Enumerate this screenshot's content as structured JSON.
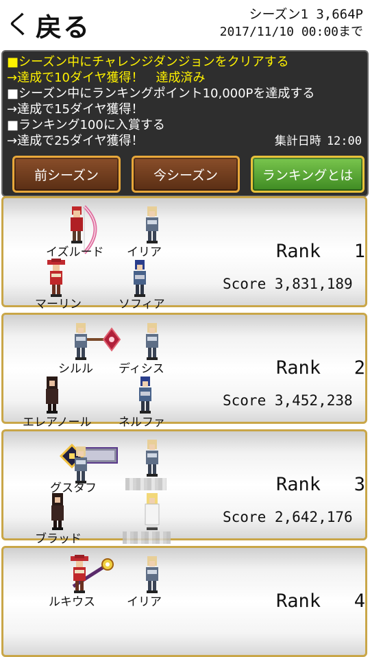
{
  "header": {
    "back_chevron": "く",
    "back_label": "戻る",
    "season_points": "シーズン1 3,664P",
    "season_end": "2017/11/10 00:00まで"
  },
  "mission": {
    "lines": [
      "■シーズン中にチャレンジダンジョンをクリアする",
      "→達成で10ダイヤ獲得！　達成済み",
      "■シーズン中にランキングポイント10,000Pを達成する",
      "→達成で15ダイヤ獲得！",
      "■ランキング100に入賞する",
      "→達成で25ダイヤ獲得！"
    ],
    "collect_label": "集計日時",
    "collect_time": "12:00"
  },
  "buttons": {
    "prev_season": "前シーズン",
    "current_season": "今シーズン",
    "about_ranking": "ランキングとは"
  },
  "ranks": [
    {
      "rank_text": "Rank   1",
      "score_text": "Score 3,831,189",
      "names": [
        "イズルード",
        "イリア",
        "マーリン",
        "ソフィア"
      ]
    },
    {
      "rank_text": "Rank   2",
      "score_text": "Score 3,452,238",
      "names": [
        "シルル",
        "ディシス",
        "エレアノール",
        "ネルファ"
      ]
    },
    {
      "rank_text": "Rank   3",
      "score_text": "Score 2,642,176",
      "names": [
        "グスタフ",
        "",
        "ブラッド",
        ""
      ]
    },
    {
      "rank_text": "Rank   4",
      "score_text": "",
      "names": [
        "ルキウス",
        "イリア",
        "",
        ""
      ]
    }
  ],
  "colors": {
    "yellow_text": "#fff200",
    "button_border": "#e8a83a",
    "card_border": "#c9a648",
    "green_button": "#5aa832"
  }
}
